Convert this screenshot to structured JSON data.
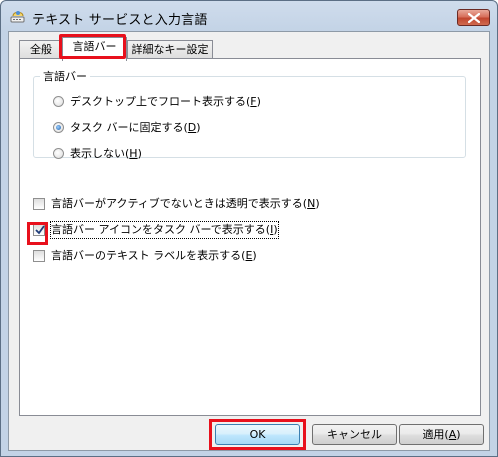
{
  "window": {
    "title": "テキスト サービスと入力言語",
    "close_label": "閉じる"
  },
  "tabs": [
    {
      "label": "全般",
      "active": false
    },
    {
      "label": "言語バー",
      "active": true
    },
    {
      "label": "詳細なキー設定",
      "active": false
    }
  ],
  "langbar_group": {
    "legend": "言語バー",
    "options": [
      {
        "text": "デスクトップ上でフロート表示する(",
        "key": "F",
        "close": ")",
        "selected": false
      },
      {
        "text": "タスク バーに固定する(",
        "key": "D",
        "close": ")",
        "selected": true
      },
      {
        "text": "表示しない(",
        "key": "H",
        "close": ")",
        "selected": false
      }
    ]
  },
  "checkboxes": [
    {
      "text": "言語バーがアクティブでないときは透明で表示する(",
      "key": "N",
      "close": ")",
      "checked": false
    },
    {
      "text": "言語バー アイコンをタスク バーで表示する(",
      "key": "I",
      "close": ")",
      "checked": true
    },
    {
      "text": "言語バーのテキスト ラベルを表示する(",
      "key": "E",
      "close": ")",
      "checked": false
    }
  ],
  "buttons": {
    "ok": "OK",
    "cancel": "キャンセル",
    "apply_text": "適用(",
    "apply_key": "A",
    "apply_close": ")"
  },
  "colors": {
    "highlight": "#e8101c",
    "title_bar": "#c3d3e6",
    "close_button": "#c1462f"
  }
}
